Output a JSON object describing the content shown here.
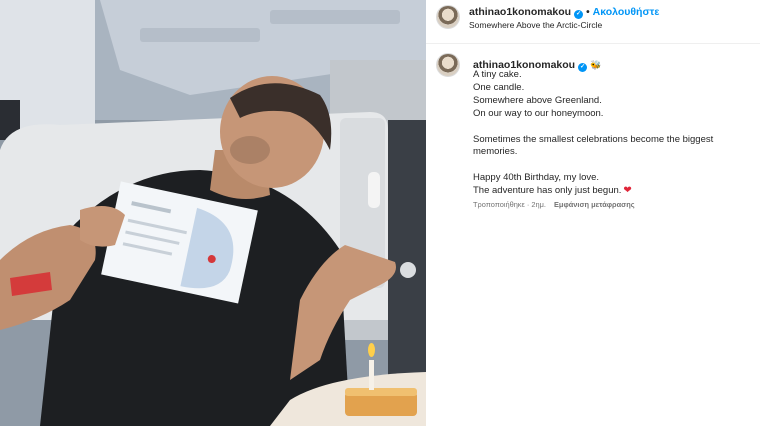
{
  "post": {
    "username": "athinao1konomakou",
    "follow_label": "Ακολουθήστε",
    "separator": "•",
    "location": "Somewhere Above the Arctic-Circle",
    "verified": true
  },
  "caption": {
    "username": "athinao1konomakou",
    "emoji": "🐝",
    "lines_1": [
      "A tiny cake.",
      "One candle.",
      "Somewhere above Greenland.",
      "On our way to our honeymoon."
    ],
    "paragraph_2": "Sometimes the smallest celebrations become the biggest memories.",
    "line_3a": "Happy 40th Birthday, my love.",
    "line_3b": "The adventure has only just begun.",
    "heart_emoji": "❤"
  },
  "meta": {
    "edited_label": "Τροποποιήθηκε",
    "separator": "·",
    "time_ago": "2ημ.",
    "translate_label": "Εμφάνιση μετάφρασης"
  },
  "colors": {
    "accent": "#0095f6",
    "text": "#262626",
    "muted": "#737373",
    "heart": "#e0263a"
  },
  "photo": {
    "description_icon": "photo-image"
  }
}
